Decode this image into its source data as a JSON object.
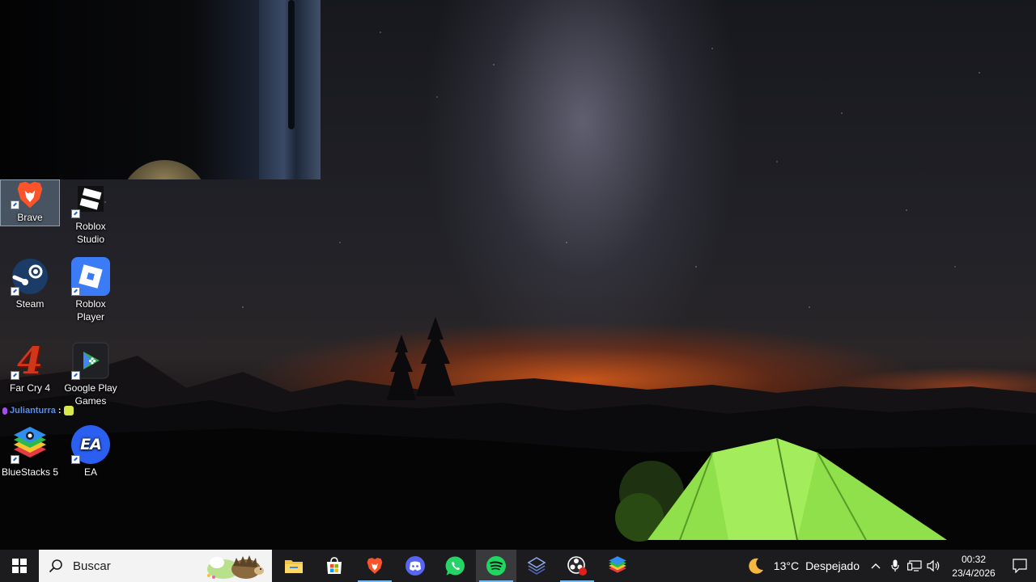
{
  "desktop": {
    "icons": {
      "brave": {
        "label": "Brave"
      },
      "roblox_studio": {
        "label": "Roblox Studio"
      },
      "steam": {
        "label": "Steam"
      },
      "roblox_player": {
        "label": "Roblox Player"
      },
      "far_cry": {
        "label": "Far Cry 4",
        "digit": "4"
      },
      "google_play_games": {
        "label": "Google Play Games"
      },
      "bluestacks": {
        "label": "BlueStacks 5"
      },
      "ea": {
        "label": "EA",
        "logo_text": "EA"
      }
    },
    "stream_chat": {
      "username": "Julianturra",
      "separator": ":"
    }
  },
  "taskbar": {
    "search": {
      "placeholder": "Buscar"
    },
    "apps": [
      "file-explorer",
      "microsoft-store",
      "brave",
      "discord",
      "whatsapp",
      "spotify",
      "app-7",
      "obs-studio",
      "bluestacks"
    ],
    "weather": {
      "temperature": "13°C",
      "condition": "Despejado"
    },
    "clock": {
      "time": "00:32",
      "date": "23/4/2026"
    }
  },
  "colors": {
    "taskbar": "#1c1c1e",
    "running_indicator": "#76b9ed",
    "brave": "#fb542b",
    "roblox_blue": "#3b7bf5",
    "ea_blue": "#2b5ff0",
    "spotify": "#1ed760",
    "whatsapp": "#25d366",
    "discord": "#5865f2",
    "tent": "#8fe04a"
  }
}
